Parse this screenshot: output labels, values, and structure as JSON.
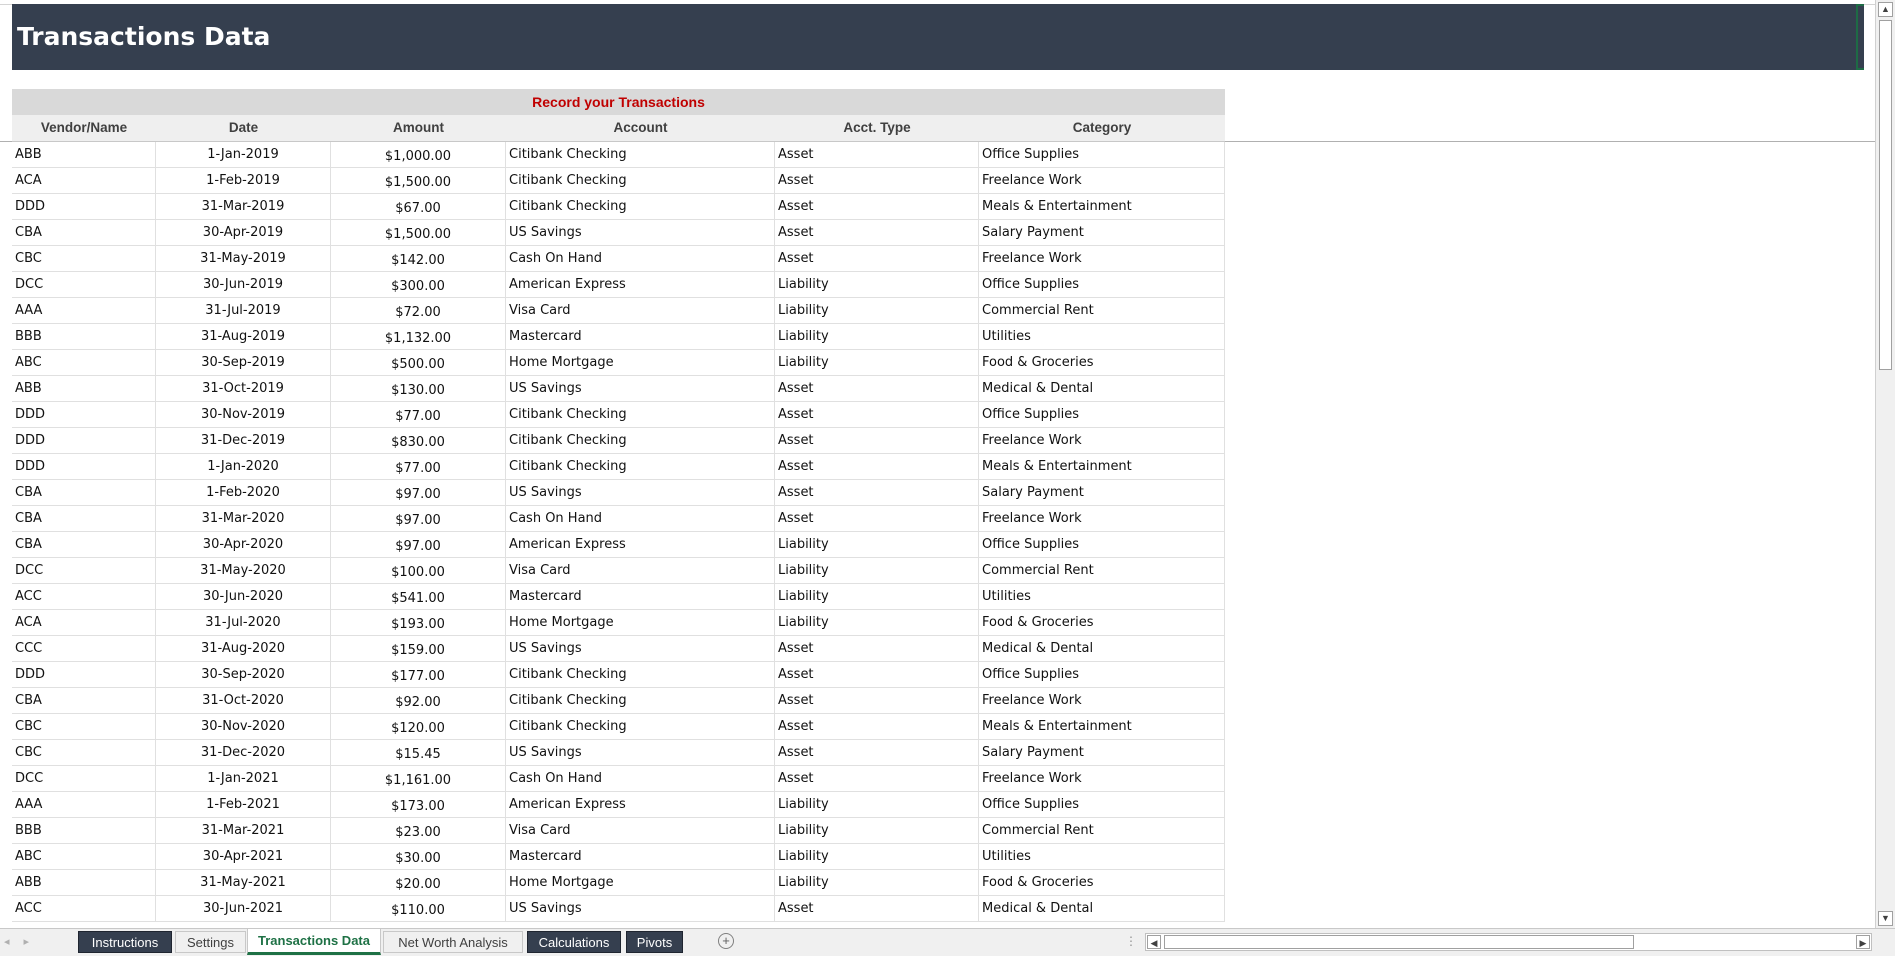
{
  "title": "Transactions Data",
  "table": {
    "section_header": "Record your Transactions",
    "columns": [
      "Vendor/Name",
      "Date",
      "Amount",
      "Account",
      "Acct. Type",
      "Category"
    ],
    "rows": [
      [
        "ABB",
        "1-Jan-2019",
        "$1,000.00",
        "Citibank Checking",
        "Asset",
        "Office Supplies"
      ],
      [
        "ACA",
        "1-Feb-2019",
        "$1,500.00",
        "Citibank Checking",
        "Asset",
        "Freelance Work"
      ],
      [
        "DDD",
        "31-Mar-2019",
        "$67.00",
        "Citibank Checking",
        "Asset",
        "Meals & Entertainment"
      ],
      [
        "CBA",
        "30-Apr-2019",
        "$1,500.00",
        "US Savings",
        "Asset",
        "Salary Payment"
      ],
      [
        "CBC",
        "31-May-2019",
        "$142.00",
        "Cash On Hand",
        "Asset",
        "Freelance Work"
      ],
      [
        "DCC",
        "30-Jun-2019",
        "$300.00",
        "American Express",
        "Liability",
        "Office Supplies"
      ],
      [
        "AAA",
        "31-Jul-2019",
        "$72.00",
        "Visa Card",
        "Liability",
        "Commercial Rent"
      ],
      [
        "BBB",
        "31-Aug-2019",
        "$1,132.00",
        "Mastercard",
        "Liability",
        "Utilities"
      ],
      [
        "ABC",
        "30-Sep-2019",
        "$500.00",
        "Home Mortgage",
        "Liability",
        "Food & Groceries"
      ],
      [
        "ABB",
        "31-Oct-2019",
        "$130.00",
        "US Savings",
        "Asset",
        "Medical & Dental"
      ],
      [
        "DDD",
        "30-Nov-2019",
        "$77.00",
        "Citibank Checking",
        "Asset",
        "Office Supplies"
      ],
      [
        "DDD",
        "31-Dec-2019",
        "$830.00",
        "Citibank Checking",
        "Asset",
        "Freelance Work"
      ],
      [
        "DDD",
        "1-Jan-2020",
        "$77.00",
        "Citibank Checking",
        "Asset",
        "Meals & Entertainment"
      ],
      [
        "CBA",
        "1-Feb-2020",
        "$97.00",
        "US Savings",
        "Asset",
        "Salary Payment"
      ],
      [
        "CBA",
        "31-Mar-2020",
        "$97.00",
        "Cash On Hand",
        "Asset",
        "Freelance Work"
      ],
      [
        "CBA",
        "30-Apr-2020",
        "$97.00",
        "American Express",
        "Liability",
        "Office Supplies"
      ],
      [
        "DCC",
        "31-May-2020",
        "$100.00",
        "Visa Card",
        "Liability",
        "Commercial Rent"
      ],
      [
        "ACC",
        "30-Jun-2020",
        "$541.00",
        "Mastercard",
        "Liability",
        "Utilities"
      ],
      [
        "ACA",
        "31-Jul-2020",
        "$193.00",
        "Home Mortgage",
        "Liability",
        "Food & Groceries"
      ],
      [
        "CCC",
        "31-Aug-2020",
        "$159.00",
        "US Savings",
        "Asset",
        "Medical & Dental"
      ],
      [
        "DDD",
        "30-Sep-2020",
        "$177.00",
        "Citibank Checking",
        "Asset",
        "Office Supplies"
      ],
      [
        "CBA",
        "31-Oct-2020",
        "$92.00",
        "Citibank Checking",
        "Asset",
        "Freelance Work"
      ],
      [
        "CBC",
        "30-Nov-2020",
        "$120.00",
        "Citibank Checking",
        "Asset",
        "Meals & Entertainment"
      ],
      [
        "CBC",
        "31-Dec-2020",
        "$15.45",
        "US Savings",
        "Asset",
        "Salary Payment"
      ],
      [
        "DCC",
        "1-Jan-2021",
        "$1,161.00",
        "Cash On Hand",
        "Asset",
        "Freelance Work"
      ],
      [
        "AAA",
        "1-Feb-2021",
        "$173.00",
        "American Express",
        "Liability",
        "Office Supplies"
      ],
      [
        "BBB",
        "31-Mar-2021",
        "$23.00",
        "Visa Card",
        "Liability",
        "Commercial Rent"
      ],
      [
        "ABC",
        "30-Apr-2021",
        "$30.00",
        "Mastercard",
        "Liability",
        "Utilities"
      ],
      [
        "ABB",
        "31-May-2021",
        "$20.00",
        "Home Mortgage",
        "Liability",
        "Food & Groceries"
      ],
      [
        "ACC",
        "30-Jun-2021",
        "$110.00",
        "US Savings",
        "Asset",
        "Medical & Dental"
      ]
    ]
  },
  "tabs": [
    {
      "label": "Instructions",
      "style": "dark"
    },
    {
      "label": "Settings",
      "style": "light"
    },
    {
      "label": "Transactions Data",
      "style": "active"
    },
    {
      "label": "Net Worth Analysis",
      "style": "light"
    },
    {
      "label": "Calculations",
      "style": "dark"
    },
    {
      "label": "Pivots",
      "style": "dark"
    }
  ],
  "icons": {
    "add_sheet": "plus-circle-icon",
    "nav_prev": "chevron-left-icon",
    "nav_next": "chevron-right-icon"
  },
  "colors": {
    "banner": "#353f4f",
    "section_header_text": "#c00000",
    "active_tab": "#1e7145"
  }
}
